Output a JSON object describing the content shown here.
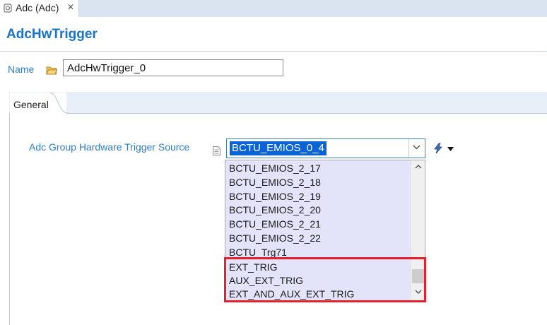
{
  "tab": {
    "label": "Adc (Adc)",
    "close": "✕",
    "icon": "component-icon"
  },
  "header": {
    "title": "AdcHwTrigger"
  },
  "name_field": {
    "label": "Name",
    "value": "AdcHwTrigger_0",
    "icon": "folder-icon"
  },
  "general_tab": {
    "label": "General"
  },
  "trigger_source": {
    "label": "Adc Group Hardware Trigger Source",
    "selected": "BCTU_EMIOS_0_4",
    "info_icon": "document-icon",
    "action_icon": "action-icon"
  },
  "dropdown": {
    "options": [
      "BCTU_EMIOS_2_17",
      "BCTU_EMIOS_2_18",
      "BCTU_EMIOS_2_19",
      "BCTU_EMIOS_2_20",
      "BCTU_EMIOS_2_21",
      "BCTU_EMIOS_2_22",
      "BCTU_Trg71",
      "EXT_TRIG",
      "AUX_EXT_TRIG",
      "EXT_AND_AUX_EXT_TRIG"
    ]
  },
  "colors": {
    "accent": "#1a73c8",
    "label": "#2e7dc8",
    "selection": "#0a64d6",
    "highlight": "#e3202b",
    "list_bg": "#e3e3f9"
  }
}
